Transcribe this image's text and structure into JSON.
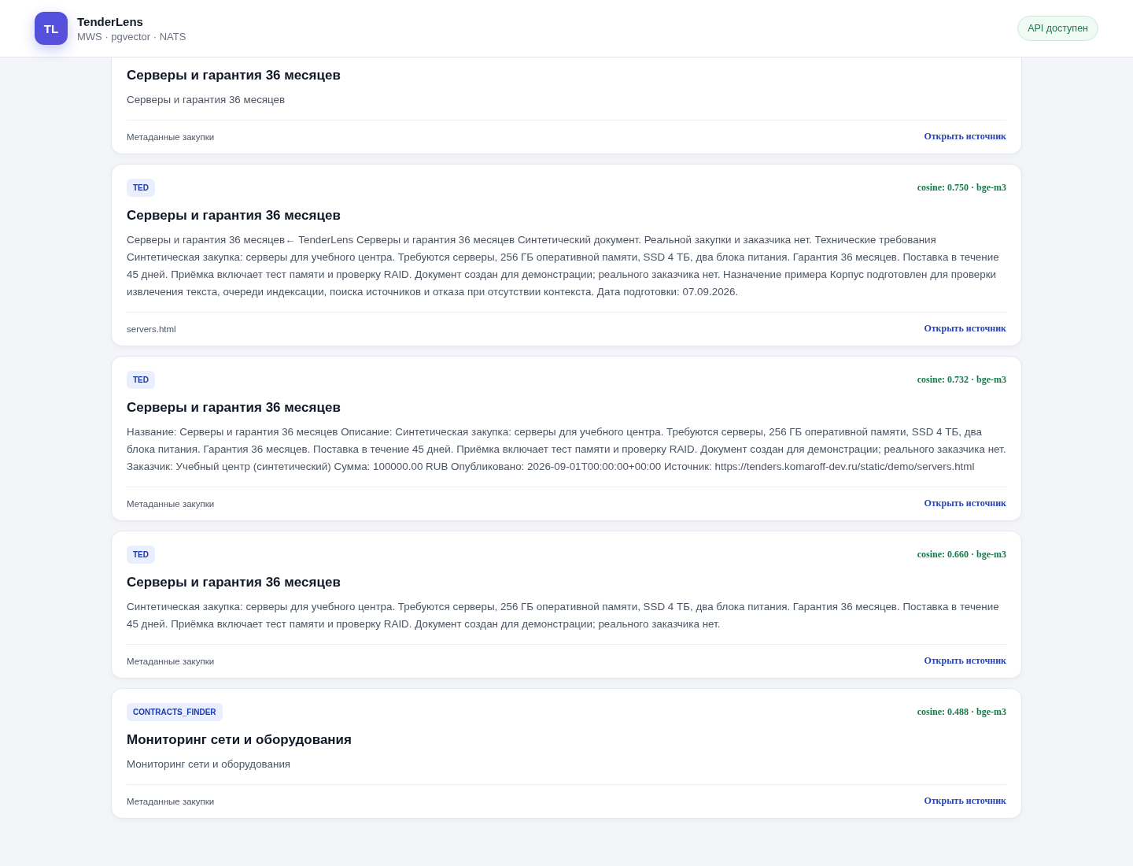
{
  "header": {
    "logo": "TL",
    "title": "TenderLens",
    "subtitle": "MWS · pgvector · NATS",
    "status": "API доступен"
  },
  "results": [
    {
      "title": "Серверы и гарантия 36 месяцев",
      "snippet": "Серверы и гарантия 36 месяцев",
      "meta": "Метаданные закупки",
      "link": "Открыть источник"
    },
    {
      "source": "TED",
      "score": "cosine: 0.750 · bge-m3",
      "title": "Серверы и гарантия 36 месяцев",
      "snippet": "Серверы и гарантия 36 месяцев← TenderLens Серверы и гарантия 36 месяцев Синтетический документ. Реальной закупки и заказчика нет. Технические требования Синтетическая закупка: серверы для учебного центра. Требуются серверы, 256 ГБ оперативной памяти, SSD 4 ТБ, два блока питания. Гарантия 36 месяцев. Поставка в течение 45 дней. Приёмка включает тест памяти и проверку RAID. Документ создан для демонстрации; реального заказчика нет. Назначение примера Корпус подготовлен для проверки извлечения текста, очереди индексации, поиска источников и отказа при отсутствии контекста. Дата подготовки: 07.09.2026.",
      "meta": "servers.html",
      "link": "Открыть источник"
    },
    {
      "source": "TED",
      "score": "cosine: 0.732 · bge-m3",
      "title": "Серверы и гарантия 36 месяцев",
      "snippet": "Название: Серверы и гарантия 36 месяцев Описание: Синтетическая закупка: серверы для учебного центра. Требуются серверы, 256 ГБ оперативной памяти, SSD 4 ТБ, два блока питания. Гарантия 36 месяцев. Поставка в течение 45 дней. Приёмка включает тест памяти и проверку RAID. Документ создан для демонстрации; реального заказчика нет. Заказчик: Учебный центр (синтетический) Сумма: 100000.00 RUB Опубликовано: 2026-09-01T00:00:00+00:00 Источник: https://tenders.komaroff-dev.ru/static/demo/servers.html",
      "meta": "Метаданные закупки",
      "link": "Открыть источник"
    },
    {
      "source": "TED",
      "score": "cosine: 0.660 · bge-m3",
      "title": "Серверы и гарантия 36 месяцев",
      "snippet": "Синтетическая закупка: серверы для учебного центра. Требуются серверы, 256 ГБ оперативной памяти, SSD 4 ТБ, два блока питания. Гарантия 36 месяцев. Поставка в течение 45 дней. Приёмка включает тест памяти и проверку RAID. Документ создан для демонстрации; реального заказчика нет.",
      "meta": "Метаданные закупки",
      "link": "Открыть источник"
    },
    {
      "source": "CONTRACTS_FINDER",
      "score": "cosine: 0.488 · bge-m3",
      "title": "Мониторинг сети и оборудования",
      "snippet": "Мониторинг сети и оборудования",
      "meta": "Метаданные закупки",
      "link": "Открыть источник"
    }
  ]
}
